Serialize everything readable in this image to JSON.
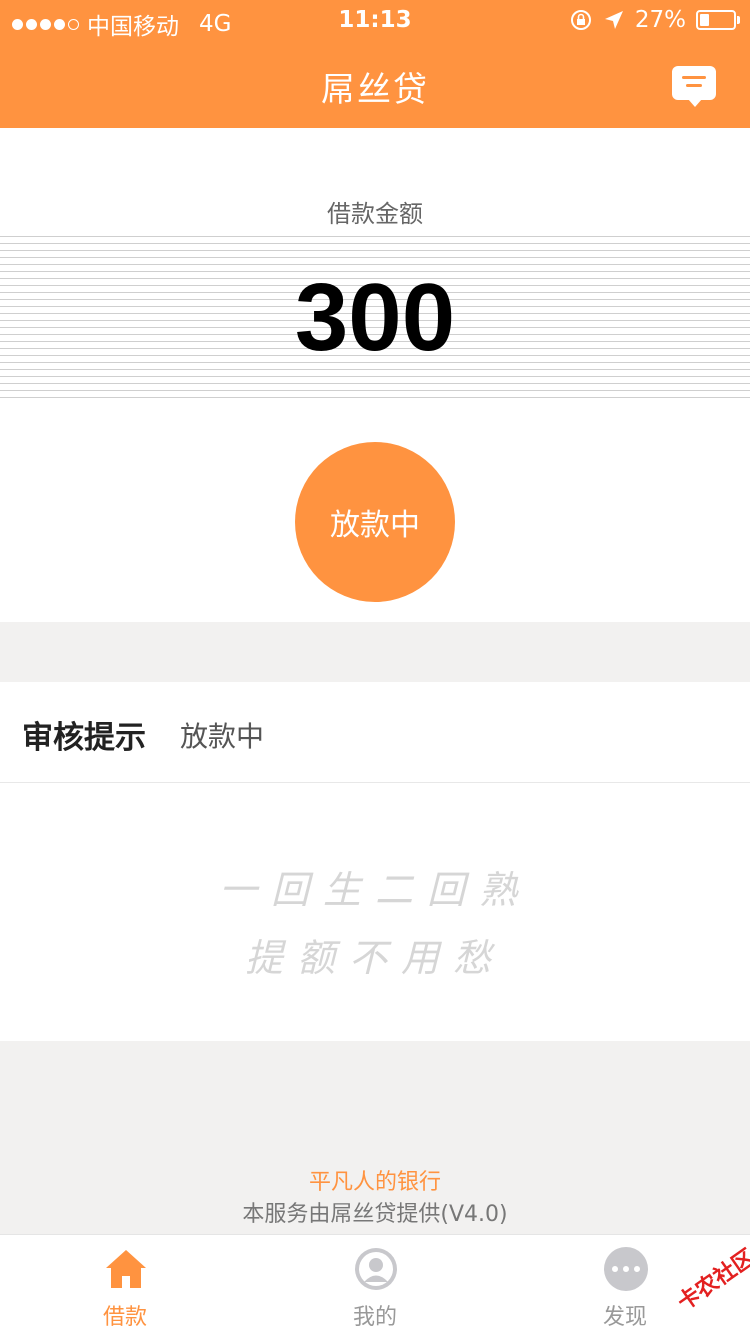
{
  "status_bar": {
    "carrier": "中国移动",
    "network": "4G",
    "time": "11:13",
    "battery": "27%",
    "battery_level": 0.27
  },
  "navbar": {
    "title": "屌丝贷"
  },
  "loan": {
    "amount_label": "借款金额",
    "amount": "300",
    "status": "放款中"
  },
  "review": {
    "title": "审核提示",
    "status": "放款中"
  },
  "slogan": {
    "line1": "一回生二回熟",
    "line2": "提额不用愁"
  },
  "footer": {
    "tagline": "平凡人的银行",
    "provider": "本服务由屌丝贷提供(V4.0)"
  },
  "tabs": [
    {
      "label": "借款",
      "icon": "home-icon",
      "active": true
    },
    {
      "label": "我的",
      "icon": "user-icon",
      "active": false
    },
    {
      "label": "发现",
      "icon": "more-icon",
      "active": false
    }
  ],
  "watermark": "卡农社区",
  "colors": {
    "accent": "#ff9340",
    "background": "#f2f1f0",
    "inactive": "#999999"
  }
}
